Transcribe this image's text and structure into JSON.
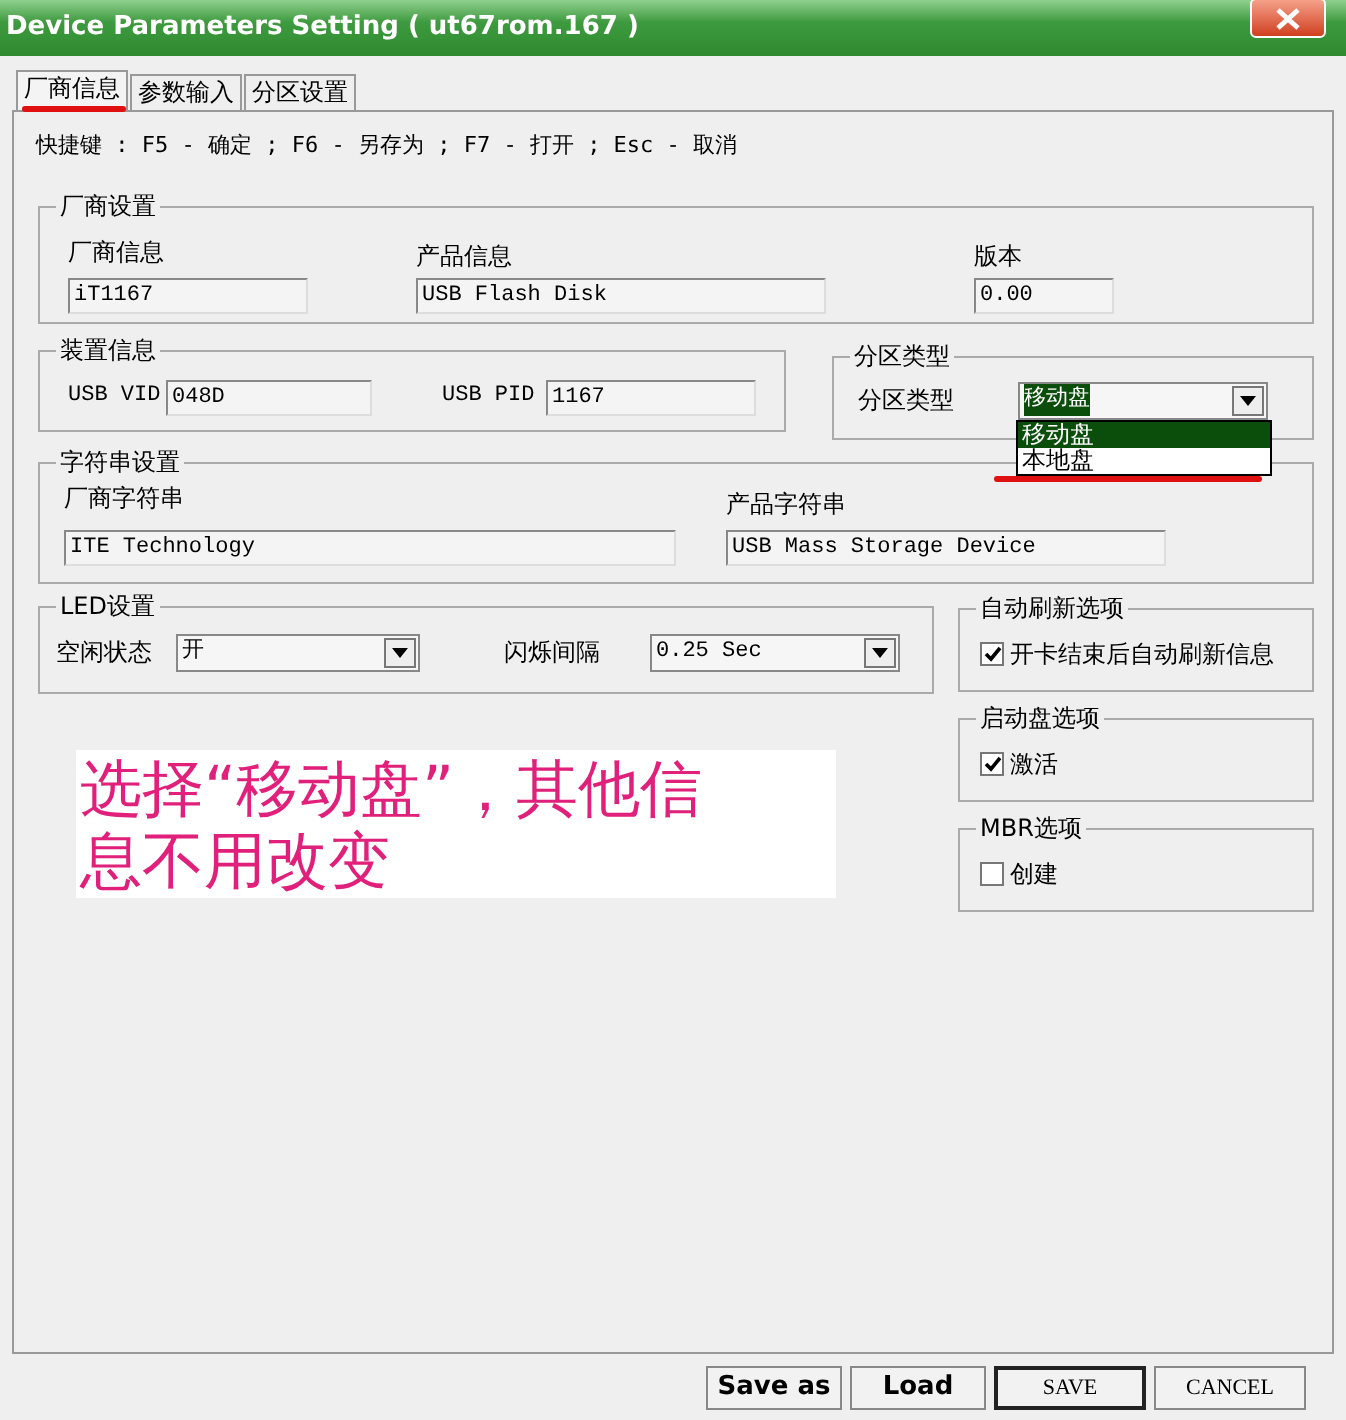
{
  "window": {
    "title": "Device Parameters Setting ( ut67rom.167 )"
  },
  "tabs": [
    {
      "label": "厂商信息",
      "selected": true
    },
    {
      "label": "参数输入",
      "selected": false
    },
    {
      "label": "分区设置",
      "selected": false
    }
  ],
  "hotkeys": "快捷键 : F5 - 确定 ; F6 - 另存为 ; F7 - 打开 ; Esc - 取消",
  "vendor_settings": {
    "title": "厂商设置",
    "fields": [
      {
        "label": "厂商信息",
        "value": "iT1167"
      },
      {
        "label": "产品信息",
        "value": "USB Flash Disk"
      },
      {
        "label": "版本",
        "value": "0.00"
      }
    ]
  },
  "device_info": {
    "title": "装置信息",
    "fields": [
      {
        "label": "USB VID",
        "value": "048D"
      },
      {
        "label": "USB PID",
        "value": "1167"
      }
    ]
  },
  "partition_type": {
    "title": "分区类型",
    "label": "分区类型",
    "value": "移动盘",
    "expanded": true,
    "options": [
      {
        "label": "移动盘",
        "selected": true
      },
      {
        "label": "本地盘",
        "selected": false
      }
    ]
  },
  "string_settings": {
    "title": "字符串设置",
    "fields": [
      {
        "label": "厂商字符串",
        "value": "ITE Technology"
      },
      {
        "label": "产品字符串",
        "value": "USB Mass Storage Device"
      }
    ]
  },
  "led_settings": {
    "title": "LED设置",
    "fields": [
      {
        "label": "空闲状态",
        "value": "开"
      },
      {
        "label": "闪烁间隔",
        "value": "0.25 Sec"
      }
    ]
  },
  "option_groups": [
    {
      "title": "自动刷新选项",
      "options": [
        {
          "label": "开卡结束后自动刷新信息",
          "checked": true
        }
      ]
    },
    {
      "title": "启动盘选项",
      "options": [
        {
          "label": "激活",
          "checked": true
        }
      ]
    },
    {
      "title": "MBR选项",
      "options": [
        {
          "label": "创建",
          "checked": false
        }
      ]
    }
  ],
  "annotation": "选择“移动盘”，其他信息不用改变",
  "buttons": [
    {
      "label": "Save as",
      "kind": "bold",
      "default": false
    },
    {
      "label": "Load",
      "kind": "bold",
      "default": false
    },
    {
      "label": "SAVE",
      "kind": "classic",
      "default": true
    },
    {
      "label": "CANCEL",
      "kind": "classic",
      "default": false
    }
  ]
}
